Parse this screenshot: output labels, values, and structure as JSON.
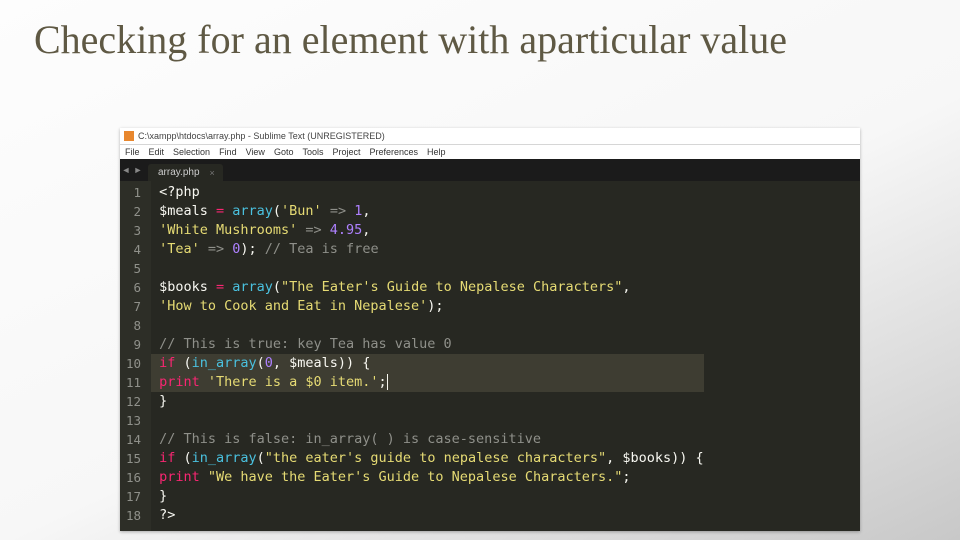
{
  "slide": {
    "title": "Checking for an element with aparticular value"
  },
  "window": {
    "title": "C:\\xampp\\htdocs\\array.php - Sublime Text (UNREGISTERED)",
    "menu": [
      "File",
      "Edit",
      "Selection",
      "Find",
      "View",
      "Goto",
      "Tools",
      "Project",
      "Preferences",
      "Help"
    ],
    "tab": {
      "name": "array.php",
      "close": "×"
    },
    "nav_back": "◄",
    "nav_fwd": "►"
  },
  "code": {
    "lines": [
      {
        "n": "1",
        "html": "<span class='s-var'>&lt;?php</span>"
      },
      {
        "n": "2",
        "html": "<span class='s-var'>$meals</span> <span class='s-kw'>=</span> <span class='s-fn'>array</span>(<span class='s-str'>'Bun'</span> <span class='s-arr'>=&gt;</span> <span class='s-num'>1</span>,"
      },
      {
        "n": "3",
        "html": "<span class='s-str'>'White Mushrooms'</span> <span class='s-arr'>=&gt;</span> <span class='s-num'>4.95</span>,"
      },
      {
        "n": "4",
        "html": "<span class='s-str'>'Tea'</span> <span class='s-arr'>=&gt;</span> <span class='s-num'>0</span>); <span class='s-com'>// Tea is free</span>"
      },
      {
        "n": "5",
        "html": ""
      },
      {
        "n": "6",
        "html": "<span class='s-var'>$books</span> <span class='s-kw'>=</span> <span class='s-fn'>array</span>(<span class='s-str'>\"The Eater's Guide to Nepalese Characters\"</span>,"
      },
      {
        "n": "7",
        "html": "<span class='s-str'>'How to Cook and Eat in Nepalese'</span>);"
      },
      {
        "n": "8",
        "html": ""
      },
      {
        "n": "9",
        "html": "<span class='s-com'>// This is true: key Tea has value 0</span>"
      },
      {
        "n": "10",
        "hl": true,
        "html": "<span class='s-kw'>if</span> (<span class='s-fn'>in_array</span>(<span class='s-num'>0</span>, $meals)) {"
      },
      {
        "n": "11",
        "hl": true,
        "html": "<span class='s-kw'>print</span> <span class='s-str'>'There is a $0 item.'</span>;<span style='border-left:1px solid #f8f8f0;'>&#8203;</span>"
      },
      {
        "n": "12",
        "html": "}"
      },
      {
        "n": "13",
        "html": ""
      },
      {
        "n": "14",
        "html": "<span class='s-com'>// This is false: in_array( ) is case-sensitive</span>"
      },
      {
        "n": "15",
        "html": "<span class='s-kw'>if</span> (<span class='s-fn'>in_array</span>(<span class='s-str'>\"the eater's guide to nepalese characters\"</span>, $books)) {"
      },
      {
        "n": "16",
        "html": "<span class='s-kw'>print</span> <span class='s-str'>\"We have the Eater's Guide to Nepalese Characters.\"</span>;"
      },
      {
        "n": "17",
        "html": "}"
      },
      {
        "n": "18",
        "html": "?&gt;"
      }
    ]
  }
}
